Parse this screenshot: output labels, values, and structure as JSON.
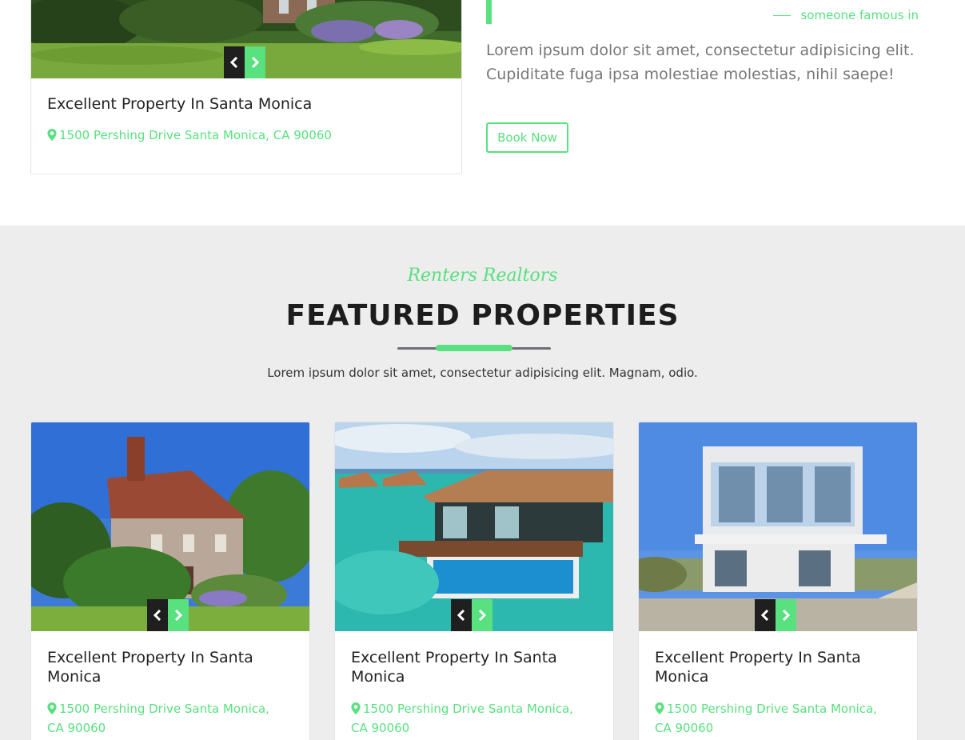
{
  "top": {
    "card": {
      "title": "Excellent Property In Santa Monica",
      "address": "1500 Pershing Drive Santa Monica, CA 90060"
    },
    "quote_author": "someone famous in",
    "about_text": "Lorem ipsum dolor sit amet, consectetur adipisicing elit. Cupiditate fuga ipsa molestiae molestias, nihil saepe!",
    "book_button": "Book Now"
  },
  "featured": {
    "script_title": "Renters Realtors",
    "heading": "FEATURED PROPERTIES",
    "description": "Lorem ipsum dolor sit amet, consectetur adipisicing elit. Magnam, odio.",
    "cards": [
      {
        "title": "Excellent Property In Santa Monica",
        "address": "1500 Pershing Drive Santa Monica, CA 90060",
        "image": "brick-cottage-photo"
      },
      {
        "title": "Excellent Property In Santa Monica",
        "address": "1500 Pershing Drive Santa Monica, CA 90060",
        "image": "overwater-villa-photo"
      },
      {
        "title": "Excellent Property In Santa Monica",
        "address": "1500 Pershing Drive Santa Monica, CA 90060",
        "image": "modern-white-house-photo"
      }
    ]
  },
  "colors": {
    "accent": "#59e07f",
    "dark": "#1f1f1f",
    "section_bg": "#ededed",
    "body_text": "#777777"
  },
  "icons": {
    "prev": "chevron-left-icon",
    "next": "chevron-right-icon",
    "location": "map-marker-icon"
  }
}
